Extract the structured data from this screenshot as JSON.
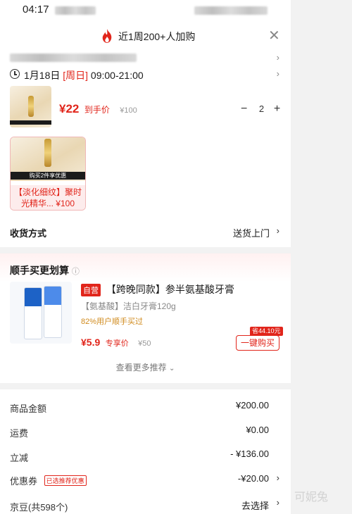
{
  "status_bar": {
    "time": "04:17"
  },
  "header": {
    "title": "近1周200+人加购",
    "close": "✕",
    "flame_color": "#e1251b"
  },
  "delivery": {
    "date": "1月18日",
    "weekday": "[周日]",
    "hours": "09:00-21:00"
  },
  "item": {
    "price": "¥22",
    "price_label": "到手价",
    "original": "¥100",
    "minus": "−",
    "qty": "2",
    "plus": "+"
  },
  "gift": {
    "badge": "购买2件享优惠",
    "caption": "【淡化细纹】聚时光精华... ¥100"
  },
  "shipping": {
    "label": "收货方式",
    "value": "送货上门",
    "chevron": "›"
  },
  "addon": {
    "title": "顺手买更划算",
    "info_icon": "ⓘ",
    "product": {
      "tag": "自营",
      "name": "【跨晚同款】参半氨基酸牙膏",
      "spec": "【氨基酸】洁白牙膏120g",
      "stat": "82%用户顺手买过",
      "price": "¥5.9",
      "price_label": "专享价",
      "original": "¥50",
      "save": "省44.10元",
      "buy": "一键购买"
    },
    "more": "查看更多推荐"
  },
  "summary": {
    "rows": [
      {
        "label": "商品金额",
        "value": "¥200.00"
      },
      {
        "label": "运费",
        "value": "¥0.00"
      },
      {
        "label": "立减",
        "value": "- ¥136.00"
      },
      {
        "label": "优惠券",
        "tag": "已选推荐优惠",
        "value": "-¥20.00"
      },
      {
        "label": "京豆(共598个)",
        "value": "去选择"
      }
    ]
  },
  "watermark": "可妮兔",
  "colors": {
    "accent": "#e1251b",
    "bg": "#f2f2f2"
  }
}
